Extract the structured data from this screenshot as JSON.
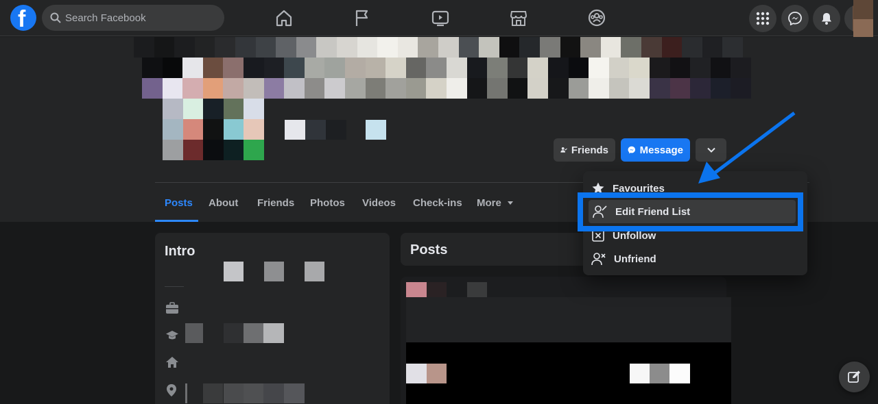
{
  "topnav": {
    "logo": "f",
    "search_placeholder": "Search Facebook",
    "nav_icons": [
      "home-icon",
      "flag-icon",
      "watch-icon",
      "marketplace-icon",
      "groups-icon"
    ],
    "right_icons": [
      "menu-grid-icon",
      "messenger-icon",
      "bell-icon"
    ]
  },
  "profile": {
    "buttons": {
      "friends_label": "Friends",
      "message_label": "Message"
    },
    "tabs": [
      {
        "label": "Posts",
        "active": true
      },
      {
        "label": "About"
      },
      {
        "label": "Friends"
      },
      {
        "label": "Photos"
      },
      {
        "label": "Videos"
      },
      {
        "label": "Check-ins"
      },
      {
        "label": "More"
      }
    ]
  },
  "intro": {
    "title": "Intro"
  },
  "posts": {
    "title": "Posts"
  },
  "friend_menu": {
    "items": [
      {
        "label": "Favourites",
        "icon": "star-icon"
      },
      {
        "label": "Edit Friend List",
        "icon": "edit-friends-icon",
        "highlighted": true
      },
      {
        "label": "Unfollow",
        "icon": "unfollow-icon"
      },
      {
        "label": "Unfriend",
        "icon": "unfriend-icon"
      }
    ]
  },
  "colors": {
    "accent": "#1877f2",
    "annotation_blue": "#0b74ee",
    "background": "#18191a",
    "card": "#242526"
  }
}
